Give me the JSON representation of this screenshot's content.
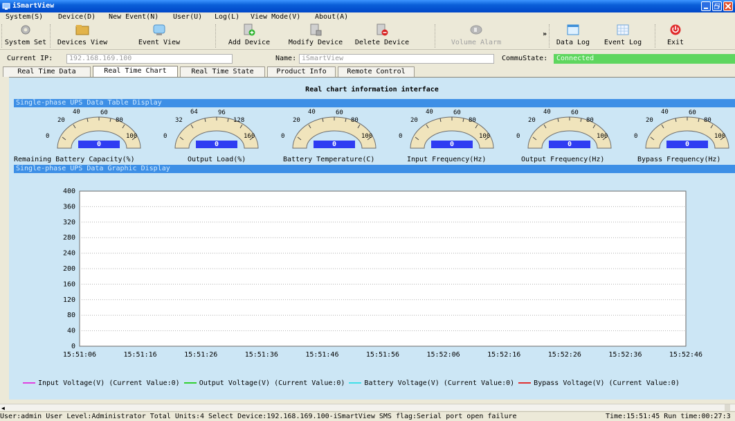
{
  "window": {
    "title": "iSmartView"
  },
  "menu": [
    "System(S)",
    "Device(D)",
    "New Event(N)",
    "User(U)",
    "Log(L)",
    "View Mode(V)",
    "About(A)"
  ],
  "toolbar": {
    "system_set": "System Set",
    "devices_view": "Devices View",
    "event_view": "Event View",
    "add_device": "Add Device",
    "modify_device": "Modify Device",
    "delete_device": "Delete Device",
    "volume_alarm": "Volume Alarm",
    "more": "»",
    "data_log": "Data Log",
    "event_log": "Event Log",
    "exit": "Exit"
  },
  "info": {
    "ip_label": "Current IP:",
    "ip_value": "192.168.169.100",
    "name_label": "Name:",
    "name_value": "iSmartView",
    "commu_label": "CommuState:",
    "commu_value": "Connected"
  },
  "tabs": [
    "Real Time Data",
    "Real Time Chart",
    "Real Time State",
    "Product Info",
    "Remote Control"
  ],
  "panel": {
    "heading": "Real chart information interface",
    "table_section": "Single-phase UPS Data Table Display",
    "graphic_section": "Single-phase UPS Data Graphic Display"
  },
  "gauges": [
    {
      "label": "Remaining Battery Capacity(%)",
      "ticks": [
        "0",
        "20",
        "40",
        "60",
        "80",
        "100"
      ],
      "value": "0"
    },
    {
      "label": "Output Load(%)",
      "ticks": [
        "0",
        "32",
        "64",
        "96",
        "128",
        "160"
      ],
      "value": "0"
    },
    {
      "label": "Battery Temperature(C)",
      "ticks": [
        "0",
        "20",
        "40",
        "60",
        "80",
        "100"
      ],
      "value": "0"
    },
    {
      "label": "Input Frequency(Hz)",
      "ticks": [
        "0",
        "20",
        "40",
        "60",
        "80",
        "100"
      ],
      "value": "0"
    },
    {
      "label": "Output Frequency(Hz)",
      "ticks": [
        "0",
        "20",
        "40",
        "60",
        "80",
        "100"
      ],
      "value": "0"
    },
    {
      "label": "Bypass Frequency(Hz)",
      "ticks": [
        "0",
        "20",
        "40",
        "60",
        "80",
        "100"
      ],
      "value": "0"
    }
  ],
  "chart_data": {
    "type": "line",
    "x": [
      "15:51:06",
      "15:51:16",
      "15:51:26",
      "15:51:36",
      "15:51:46",
      "15:51:56",
      "15:52:06",
      "15:52:16",
      "15:52:26",
      "15:52:36",
      "15:52:46"
    ],
    "y_ticks": [
      "0",
      "40",
      "80",
      "120",
      "160",
      "200",
      "240",
      "280",
      "320",
      "360",
      "400"
    ],
    "ylim": [
      0,
      400
    ],
    "grid": true,
    "series": [
      {
        "name": "Input Voltage(V)",
        "label": "Input Voltage(V)  (Current Value:0)",
        "color": "#e040e0",
        "values": []
      },
      {
        "name": "Output Voltage(V)",
        "label": "Output Voltage(V)  (Current Value:0)",
        "color": "#30d030",
        "values": []
      },
      {
        "name": "Battery Voltage(V)",
        "label": "Battery Voltage(V)  (Current Value:0)",
        "color": "#40e0e8",
        "values": []
      },
      {
        "name": "Bypass Voltage(V)",
        "label": "Bypass Voltage(V)  (Current Value:0)",
        "color": "#e03030",
        "values": []
      }
    ]
  },
  "status": {
    "left": "User:admin User Level:Administrator Total Units:4 Select Device:192.168.169.100-iSmartView SMS flag:Serial port open failure",
    "right": "Time:15:51:45 Run time:00:27:3"
  }
}
